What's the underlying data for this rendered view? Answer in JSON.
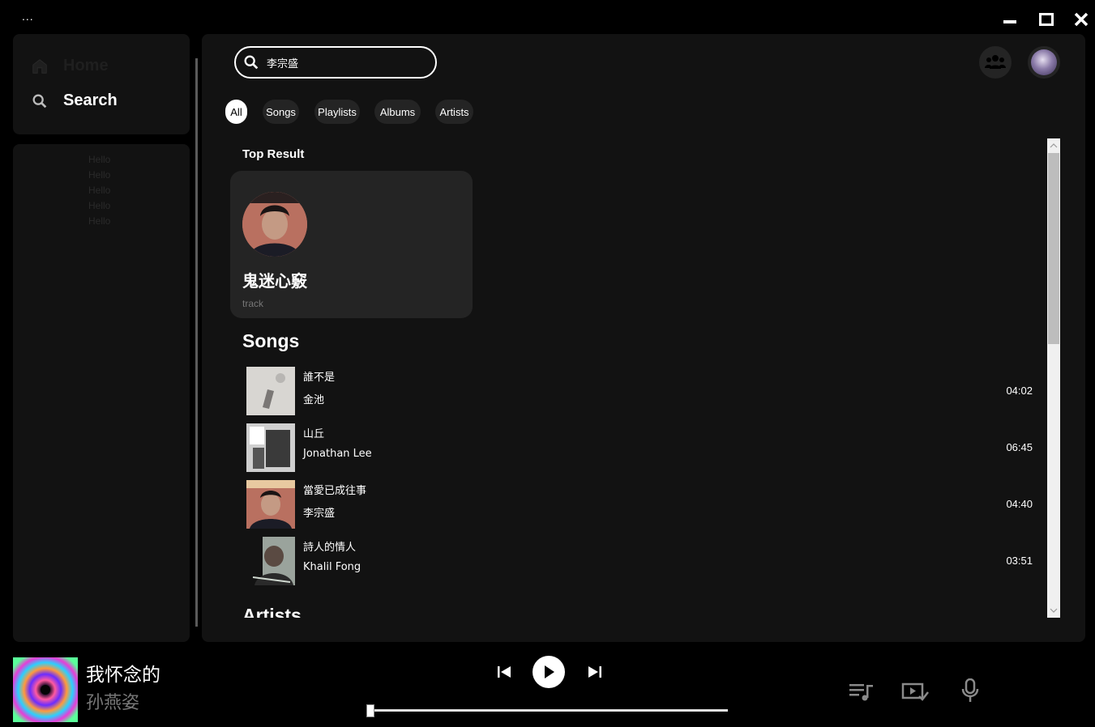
{
  "titlebar": {
    "menu_label": "..."
  },
  "nav": {
    "home_label": "Home",
    "search_label": "Search"
  },
  "library": {
    "items": [
      "Hello",
      "Hello",
      "Hello",
      "Hello",
      "Hello"
    ]
  },
  "search": {
    "query": "李宗盛"
  },
  "filters": [
    "All",
    "Songs",
    "Playlists",
    "Albums",
    "Artists"
  ],
  "top_result": {
    "heading": "Top Result",
    "title": "鬼迷心竅",
    "type": "track"
  },
  "songs": {
    "heading": "Songs",
    "items": [
      {
        "title": "誰不是",
        "artist": "金池",
        "duration": "04:02"
      },
      {
        "title": "山丘",
        "artist": "Jonathan Lee",
        "duration": "06:45"
      },
      {
        "title": "當愛已成往事",
        "artist": "李宗盛",
        "duration": "04:40"
      },
      {
        "title": "詩人的情人",
        "artist": "Khalil Fong",
        "duration": "03:51"
      }
    ]
  },
  "artists_heading": "Artists",
  "now_playing": {
    "title": "我怀念的",
    "artist": "孙燕姿",
    "progress": 0.0
  },
  "colors": {
    "panel": "#121212",
    "card": "#242424",
    "background": "#000000"
  }
}
